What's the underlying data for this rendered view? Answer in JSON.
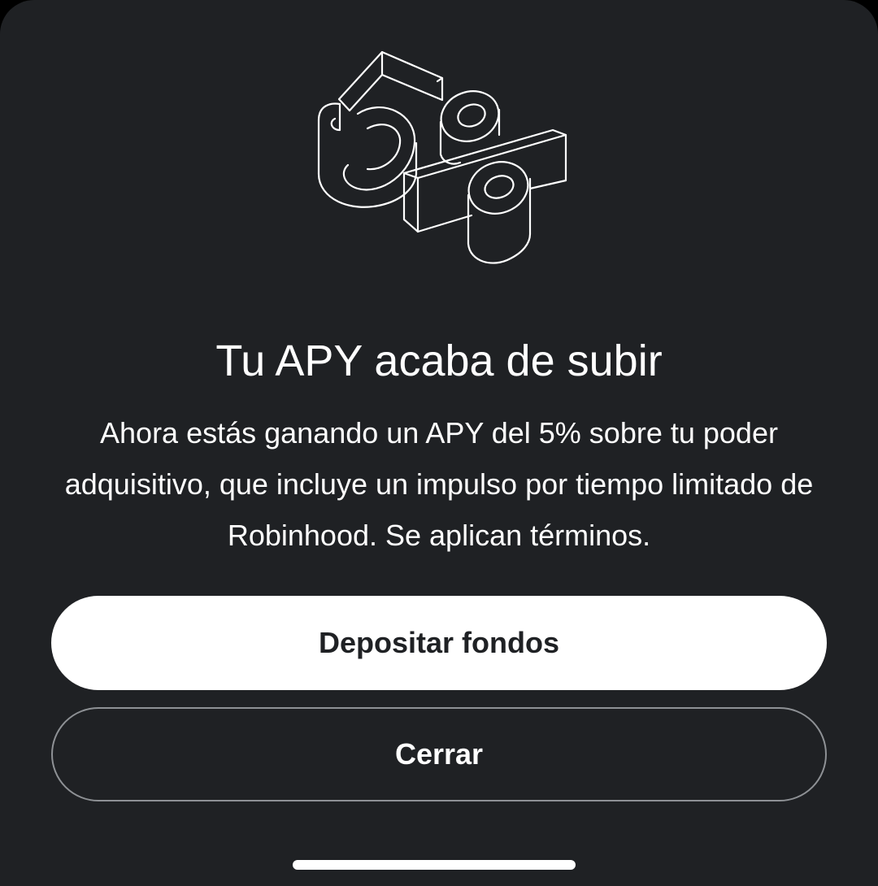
{
  "modal": {
    "illustration": "5%",
    "title": "Tu APY acaba de subir",
    "body": "Ahora estás ganando un APY del 5% sobre tu poder adquisitivo, que incluye un impulso por tiempo limitado de Robinhood. Se aplican términos.",
    "primary_button": "Depositar fondos",
    "secondary_button": "Cerrar"
  },
  "colors": {
    "background": "#1f2124",
    "text": "#ffffff",
    "primary_button_bg": "#ffffff",
    "secondary_button_border": "#8e9195"
  }
}
